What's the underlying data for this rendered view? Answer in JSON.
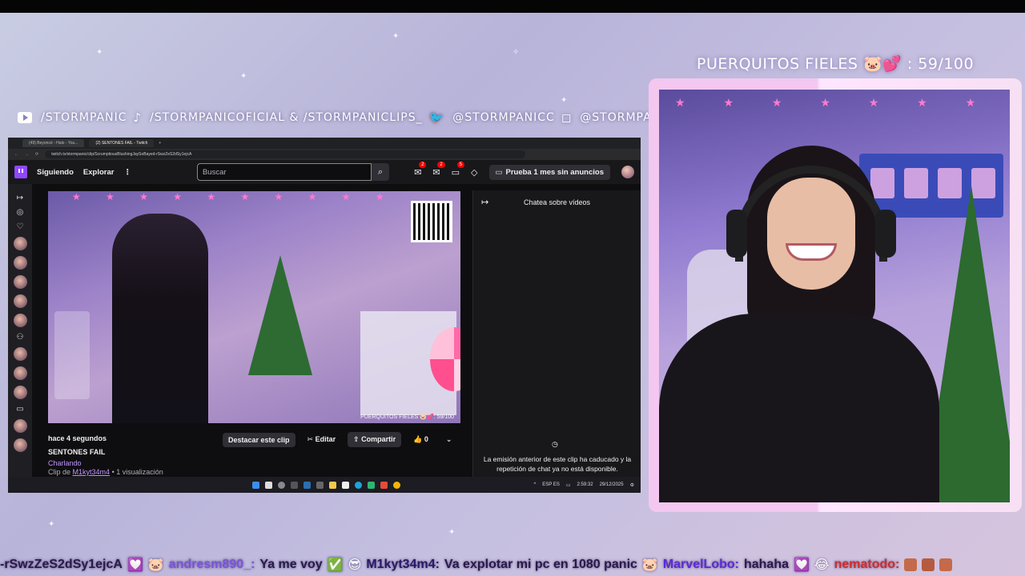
{
  "overlay": {
    "goal_label": "PUERQUITOS FIELES",
    "goal_value": ": 59/100",
    "socials": [
      {
        "icon": "youtube-icon",
        "text": "/STORMPANIC"
      },
      {
        "icon": "tiktok-icon",
        "text": "/STORMPANICOFICIAL & /STORMPANICLIPS_"
      },
      {
        "icon": "twitter-icon",
        "text": "@STORMPANICC"
      },
      {
        "icon": "instagram-icon",
        "text": "@STORMPANIC"
      }
    ]
  },
  "browser": {
    "tabs": [
      "(49) Beyoncé - Halo - You...",
      "(2) SENTONES FAIL - Twitch"
    ],
    "url": "twitch.tv/stormpanic/clip/ScrumptiousBlushingJaySoBayed-rSwzZeS2dSy1ejcA"
  },
  "twitch": {
    "nav": {
      "following": "Siguiendo",
      "browse": "Explorar",
      "more": "⋮"
    },
    "search_placeholder": "Buscar",
    "badges": {
      "inbox": "2",
      "whispers": "2",
      "notifications": "5"
    },
    "prime_label": "Prueba 1 mes sin anuncios",
    "player_overlay": "PUERQUITOS FIELES 🐷💕: 59/100",
    "clip": {
      "when": "hace 4 segundos",
      "title": "SENTONES FAIL",
      "category": "Charlando",
      "clip_by_prefix": "Clip de",
      "clip_by_user": "M1kyt34m4",
      "views": "• 1 visualización"
    },
    "actions": {
      "feature": "Destacar este clip",
      "edit": "Editar",
      "share": "Compartir",
      "likes": "0"
    },
    "chat": {
      "header": "Chatea sobre vídeos",
      "unavailable": "La emisión anterior de este clip ha caducado y la repetición de chat ya no está disponible."
    }
  },
  "taskbar": {
    "lang": "ESP ES",
    "time": "2:59:32",
    "date": "29/12/2025"
  },
  "ticker": {
    "prefix": "-rSwzZeS2dSy1ejcA",
    "messages": [
      {
        "user": "andresm890_:",
        "text": "Ya me voy"
      },
      {
        "user": "M1kyt34m4:",
        "text": "Va explotar mi pc en 1080 panic"
      },
      {
        "user": "MarvelLobo:",
        "text": "hahaha"
      },
      {
        "user": "nematodo:",
        "text": ""
      }
    ]
  },
  "colors": {
    "twitch_purple": "#9146ff",
    "link_purple": "#bf94ff",
    "badge_red": "#eb0400",
    "frame_pink": "#f3c7ef"
  }
}
